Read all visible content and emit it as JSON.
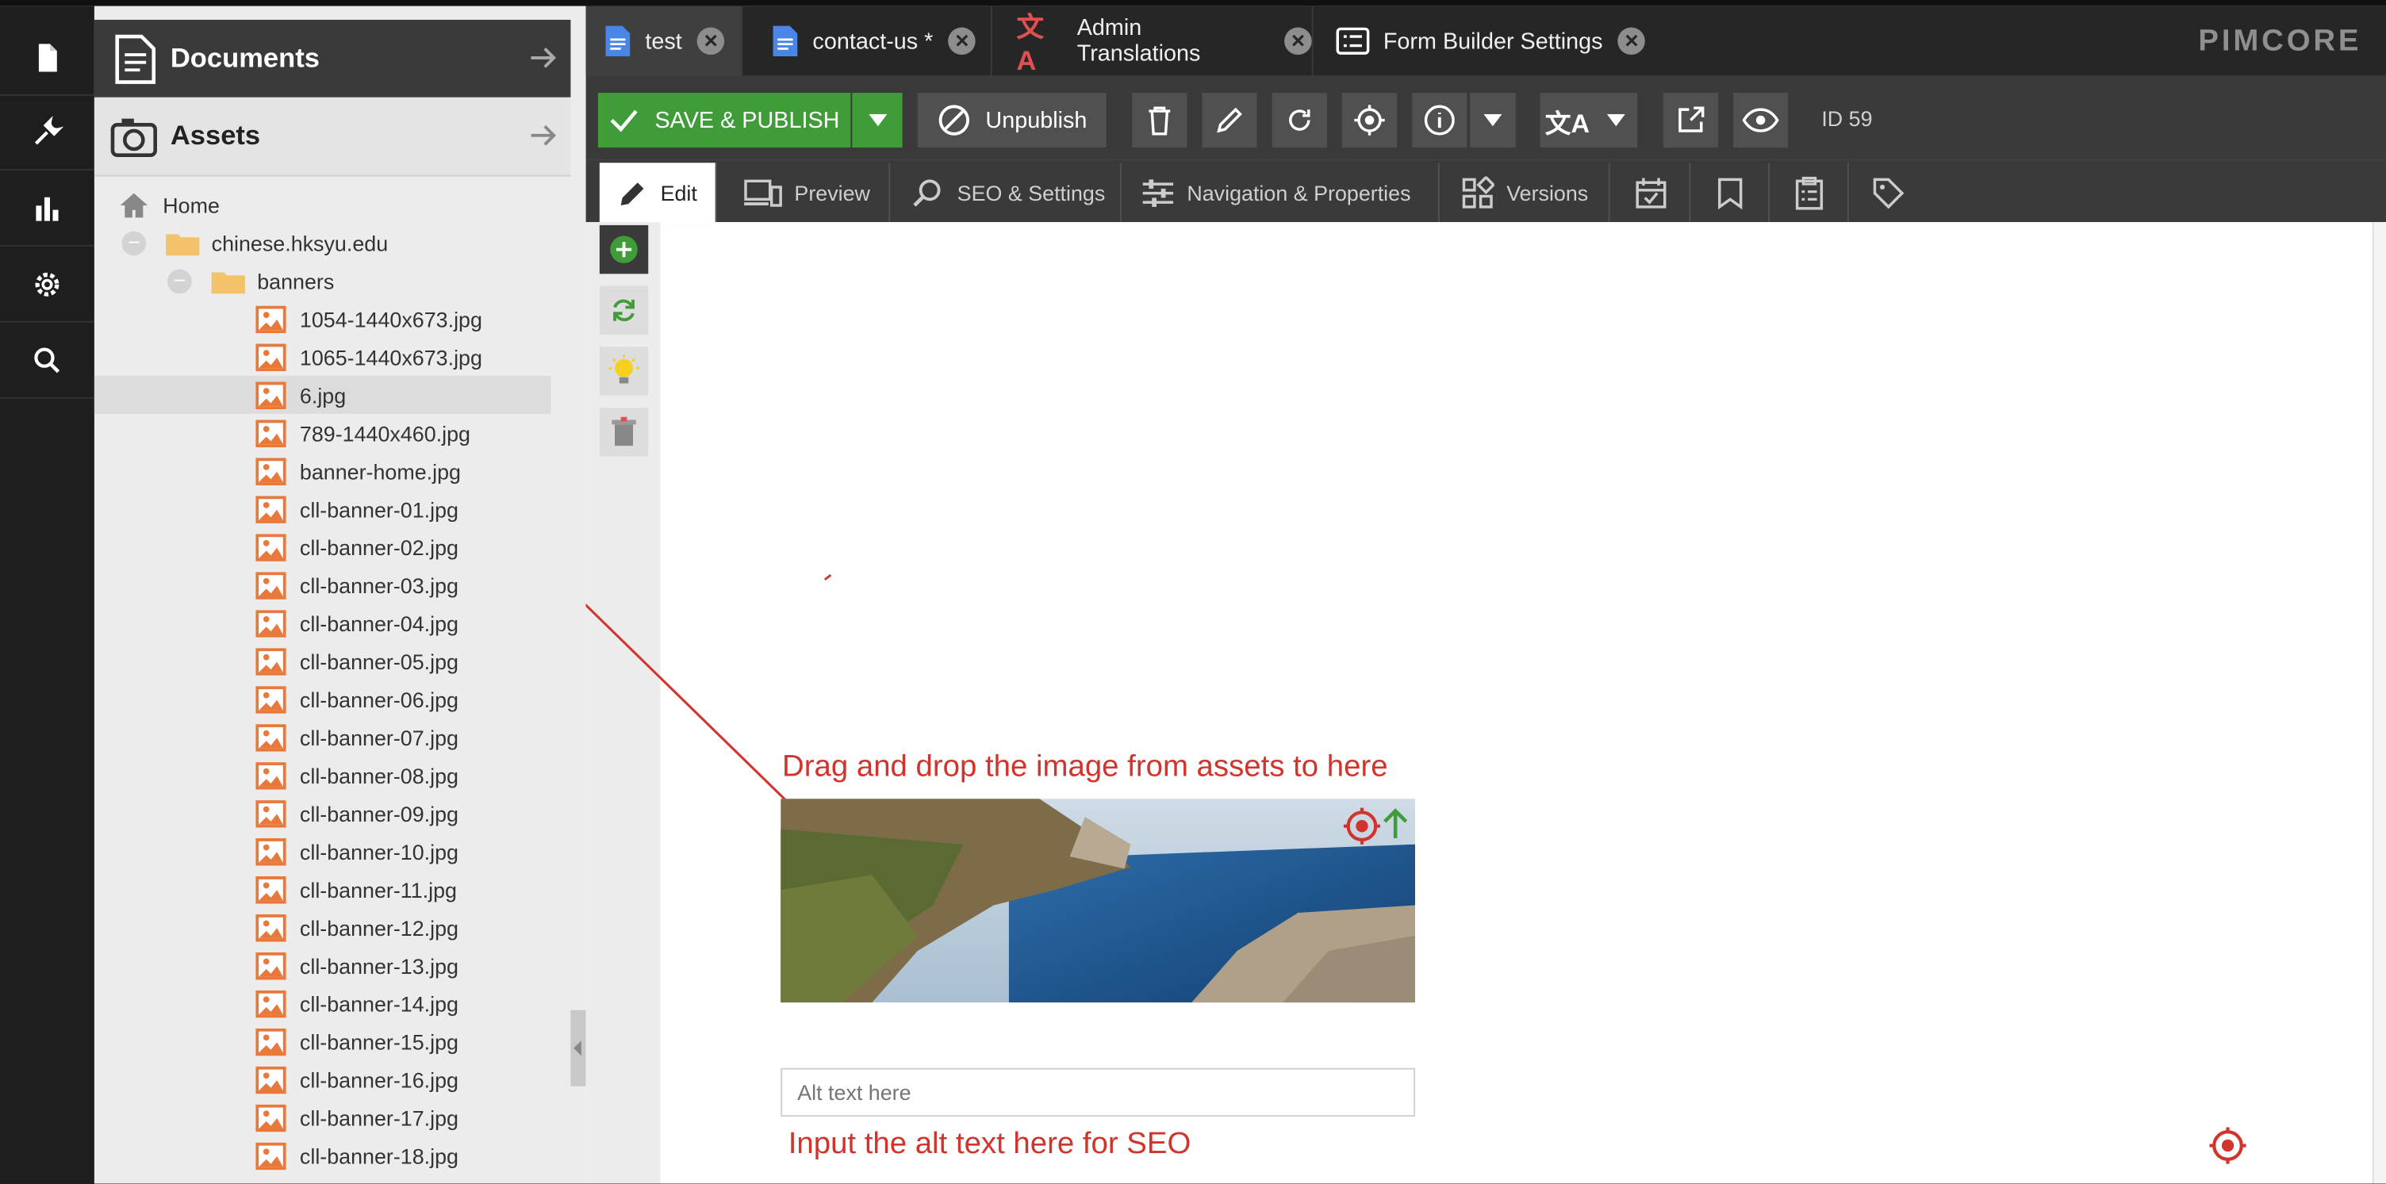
{
  "left_panel": {
    "documents_label": "Documents",
    "assets_label": "Assets",
    "tree": [
      {
        "label": "Home",
        "type": "home"
      },
      {
        "label": "chinese.hksyu.edu",
        "type": "folder"
      },
      {
        "label": "banners",
        "type": "folder"
      },
      {
        "label": "1054-1440x673.jpg",
        "type": "image"
      },
      {
        "label": "1065-1440x673.jpg",
        "type": "image"
      },
      {
        "label": "6.jpg",
        "type": "image",
        "selected": true
      },
      {
        "label": "789-1440x460.jpg",
        "type": "image"
      },
      {
        "label": "banner-home.jpg",
        "type": "image"
      },
      {
        "label": "cll-banner-01.jpg",
        "type": "image"
      },
      {
        "label": "cll-banner-02.jpg",
        "type": "image"
      },
      {
        "label": "cll-banner-03.jpg",
        "type": "image"
      },
      {
        "label": "cll-banner-04.jpg",
        "type": "image"
      },
      {
        "label": "cll-banner-05.jpg",
        "type": "image"
      },
      {
        "label": "cll-banner-06.jpg",
        "type": "image"
      },
      {
        "label": "cll-banner-07.jpg",
        "type": "image"
      },
      {
        "label": "cll-banner-08.jpg",
        "type": "image"
      },
      {
        "label": "cll-banner-09.jpg",
        "type": "image"
      },
      {
        "label": "cll-banner-10.jpg",
        "type": "image"
      },
      {
        "label": "cll-banner-11.jpg",
        "type": "image"
      },
      {
        "label": "cll-banner-12.jpg",
        "type": "image"
      },
      {
        "label": "cll-banner-13.jpg",
        "type": "image"
      },
      {
        "label": "cll-banner-14.jpg",
        "type": "image"
      },
      {
        "label": "cll-banner-15.jpg",
        "type": "image"
      },
      {
        "label": "cll-banner-16.jpg",
        "type": "image"
      },
      {
        "label": "cll-banner-17.jpg",
        "type": "image"
      },
      {
        "label": "cll-banner-18.jpg",
        "type": "image"
      }
    ]
  },
  "tabs": [
    {
      "label": "test",
      "icon": "document-icon",
      "active": true
    },
    {
      "label": "contact-us *",
      "icon": "document-icon"
    },
    {
      "label": "Admin Translations",
      "icon": "translate-icon"
    },
    {
      "label": "Form Builder Settings",
      "icon": "form-icon"
    }
  ],
  "brand": "PIMCORE",
  "toolbar": {
    "save_publish_label": "SAVE & PUBLISH",
    "unpublish_label": "Unpublish",
    "id_label": "ID 59"
  },
  "subtabs": [
    {
      "label": "Edit",
      "icon": "pencil-icon"
    },
    {
      "label": "Preview",
      "icon": "devices-icon"
    },
    {
      "label": "SEO & Settings",
      "icon": "seo-search-icon"
    },
    {
      "label": "Navigation & Properties",
      "icon": "sliders-icon"
    },
    {
      "label": "Versions",
      "icon": "versions-icon"
    }
  ],
  "editor": {
    "drag_annotation": "Drag and drop the image from assets to here",
    "alt_placeholder": "Alt text here",
    "alt_annotation": "Input the alt text here for SEO"
  },
  "colors": {
    "accent_green": "#3f9c39",
    "annotation_red": "#d0342c",
    "image_icon_orange": "#e8793a",
    "folder_yellow": "#f3c36b"
  }
}
